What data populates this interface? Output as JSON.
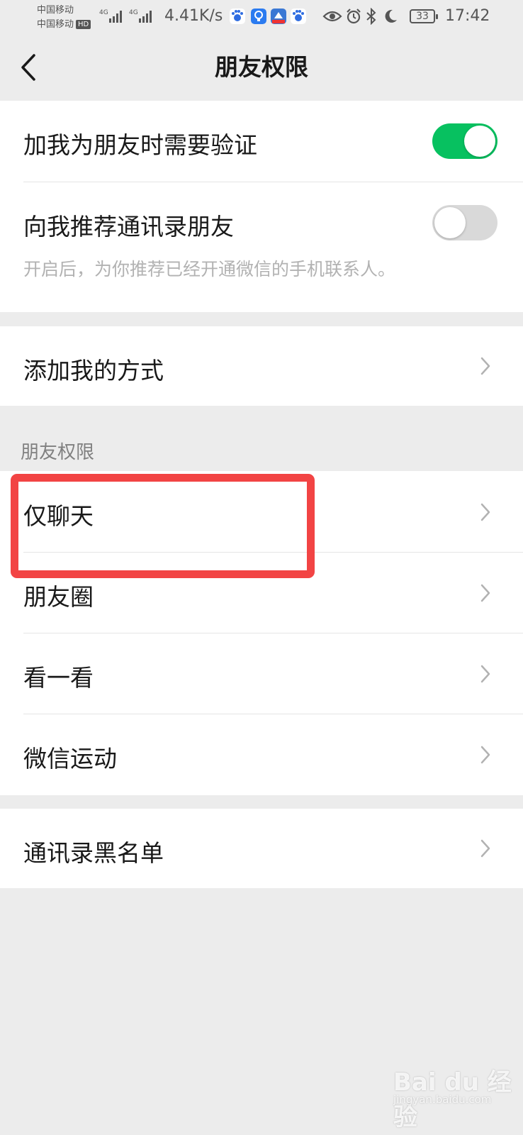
{
  "status_bar": {
    "carrier_1": "中国移动",
    "carrier_2": "中国移动",
    "hd_badge": "HD",
    "signal_1_type": "4G",
    "signal_2_type": "4G",
    "net_speed": "4.41K/s",
    "battery_level": "33",
    "time": "17:42",
    "icons": [
      "baidu-icon",
      "bulb-app-icon",
      "blue-app-icon",
      "baidu-icon",
      "eye-icon",
      "alarm-icon",
      "bluetooth-icon",
      "moon-icon",
      "battery-icon"
    ]
  },
  "nav": {
    "title": "朋友权限",
    "back_icon": "chevron-left-icon"
  },
  "verification": {
    "add_verify_label": "加我为朋友时需要验证",
    "add_verify_on": true,
    "recommend_contacts_label": "向我推荐通讯录朋友",
    "recommend_contacts_on": false,
    "recommend_contacts_desc": "开启后，为你推荐已经开通微信的手机联系人。"
  },
  "add_methods": {
    "label": "添加我的方式"
  },
  "permissions": {
    "section_title": "朋友权限",
    "items": [
      {
        "label": "仅聊天"
      },
      {
        "label": "朋友圈"
      },
      {
        "label": "看一看"
      },
      {
        "label": "微信运动"
      }
    ]
  },
  "blacklist": {
    "label": "通讯录黑名单"
  },
  "colors": {
    "toggle_on": "#07c160",
    "toggle_off": "#d9d9d9",
    "highlight_box": "#f24444",
    "page_background": "#ececec"
  },
  "watermark": {
    "brand": "Bai du 经验",
    "url": "jingyan.baidu.com"
  }
}
